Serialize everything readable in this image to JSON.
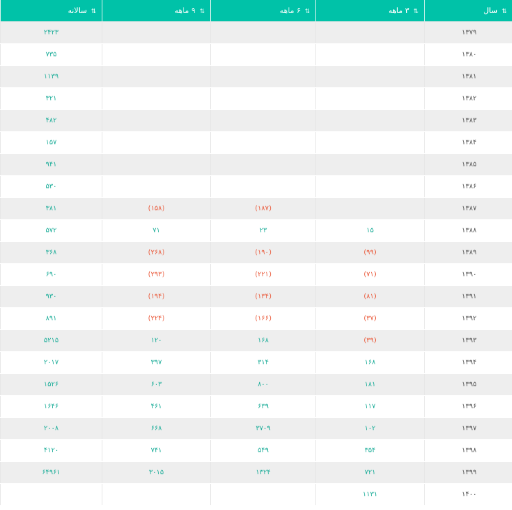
{
  "table": {
    "headers": {
      "year": "سال",
      "q3": "۳ ماهه",
      "q6": "۶ ماهه",
      "q9": "۹ ماهه",
      "annual": "سالانه"
    },
    "sort_icon": "sort-icon",
    "colors": {
      "header_bg": "#00c2a8",
      "positive": "#1fae9a",
      "negative": "#ea5a3b",
      "row_alt": "#eeeeee"
    },
    "rows": [
      {
        "year": "۱۳۷۹",
        "q3": "",
        "q6": "",
        "q9": "",
        "annual": "۲۴۲۳"
      },
      {
        "year": "۱۳۸۰",
        "q3": "",
        "q6": "",
        "q9": "",
        "annual": "۷۳۵"
      },
      {
        "year": "۱۳۸۱",
        "q3": "",
        "q6": "",
        "q9": "",
        "annual": "۱۱۳۹"
      },
      {
        "year": "۱۳۸۲",
        "q3": "",
        "q6": "",
        "q9": "",
        "annual": "۳۲۱"
      },
      {
        "year": "۱۳۸۳",
        "q3": "",
        "q6": "",
        "q9": "",
        "annual": "۴۸۲"
      },
      {
        "year": "۱۳۸۴",
        "q3": "",
        "q6": "",
        "q9": "",
        "annual": "۱۵۷"
      },
      {
        "year": "۱۳۸۵",
        "q3": "",
        "q6": "",
        "q9": "",
        "annual": "۹۴۱"
      },
      {
        "year": "۱۳۸۶",
        "q3": "",
        "q6": "",
        "q9": "",
        "annual": "۵۳۰"
      },
      {
        "year": "۱۳۸۷",
        "q3": "",
        "q6": "(۱۸۷)",
        "q9": "(۱۵۸)",
        "annual": "۳۸۱"
      },
      {
        "year": "۱۳۸۸",
        "q3": "۱۵",
        "q6": "۲۳",
        "q9": "۷۱",
        "annual": "۵۷۲"
      },
      {
        "year": "۱۳۸۹",
        "q3": "(۹۹)",
        "q6": "(۱۹۰)",
        "q9": "(۲۶۸)",
        "annual": "۳۶۸"
      },
      {
        "year": "۱۳۹۰",
        "q3": "(۷۱)",
        "q6": "(۲۲۱)",
        "q9": "(۲۹۳)",
        "annual": "۶۹۰"
      },
      {
        "year": "۱۳۹۱",
        "q3": "(۸۱)",
        "q6": "(۱۳۴)",
        "q9": "(۱۹۴)",
        "annual": "۹۳۰"
      },
      {
        "year": "۱۳۹۲",
        "q3": "(۳۷)",
        "q6": "(۱۶۶)",
        "q9": "(۲۲۴)",
        "annual": "۸۹۱"
      },
      {
        "year": "۱۳۹۳",
        "q3": "(۳۹)",
        "q6": "۱۶۸",
        "q9": "۱۲۰",
        "annual": "۵۲۱۵"
      },
      {
        "year": "۱۳۹۴",
        "q3": "۱۶۸",
        "q6": "۳۱۴",
        "q9": "۳۹۷",
        "annual": "۲۰۱۷"
      },
      {
        "year": "۱۳۹۵",
        "q3": "۱۸۱",
        "q6": "۸۰۰",
        "q9": "۶۰۳",
        "annual": "۱۵۲۶"
      },
      {
        "year": "۱۳۹۶",
        "q3": "۱۱۷",
        "q6": "۶۳۹",
        "q9": "۴۶۱",
        "annual": "۱۶۴۶"
      },
      {
        "year": "۱۳۹۷",
        "q3": "۱۰۲",
        "q6": "۳۷۰۹",
        "q9": "۶۶۸",
        "annual": "۲۰۰۸"
      },
      {
        "year": "۱۳۹۸",
        "q3": "۳۵۴",
        "q6": "۵۴۹",
        "q9": "۷۴۱",
        "annual": "۴۱۲۰"
      },
      {
        "year": "۱۳۹۹",
        "q3": "۷۲۱",
        "q6": "۱۳۲۴",
        "q9": "۳۰۱۵",
        "annual": "۶۴۹۶۱"
      },
      {
        "year": "۱۴۰۰",
        "q3": "۱۱۳۱",
        "q6": "",
        "q9": "",
        "annual": ""
      }
    ]
  }
}
